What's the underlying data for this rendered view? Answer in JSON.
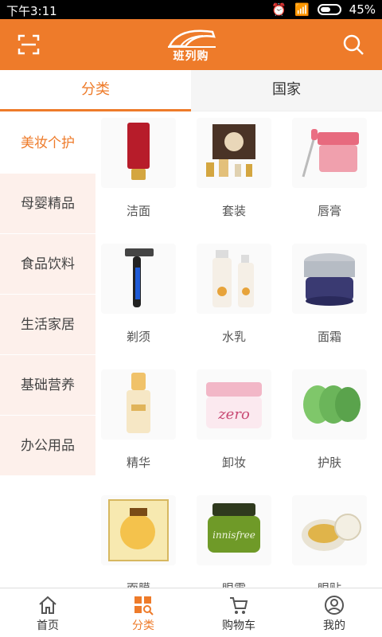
{
  "status_bar": {
    "time": "下午3:11",
    "battery": "45%"
  },
  "header": {
    "logo_text": "班列购"
  },
  "tabs": [
    {
      "label": "分类",
      "active": true
    },
    {
      "label": "国家",
      "active": false
    }
  ],
  "sidebar": {
    "items": [
      {
        "label": "美妆个护",
        "active": true
      },
      {
        "label": "母婴精品",
        "active": false
      },
      {
        "label": "食品饮料",
        "active": false
      },
      {
        "label": "生活家居",
        "active": false
      },
      {
        "label": "基础营养",
        "active": false
      },
      {
        "label": "办公用品",
        "active": false
      }
    ]
  },
  "grid": {
    "items": [
      {
        "label": "洁面",
        "icon": "cleanser-tube"
      },
      {
        "label": "套装",
        "icon": "gift-set"
      },
      {
        "label": "唇膏",
        "icon": "lip-mask-jar"
      },
      {
        "label": "剃须",
        "icon": "razor"
      },
      {
        "label": "水乳",
        "icon": "lotion-bottles"
      },
      {
        "label": "面霜",
        "icon": "cream-jar"
      },
      {
        "label": "精华",
        "icon": "serum-bottle"
      },
      {
        "label": "卸妆",
        "icon": "cleansing-balm"
      },
      {
        "label": "护肤",
        "icon": "aloe-pads"
      },
      {
        "label": "面膜",
        "icon": "face-mask-box"
      },
      {
        "label": "眼霜",
        "icon": "green-eye-cream"
      },
      {
        "label": "眼贴",
        "icon": "eye-patch-jar"
      }
    ]
  },
  "bottom_nav": [
    {
      "label": "首页",
      "icon": "home-icon",
      "active": false
    },
    {
      "label": "分类",
      "icon": "category-icon",
      "active": true
    },
    {
      "label": "购物车",
      "icon": "cart-icon",
      "active": false
    },
    {
      "label": "我的",
      "icon": "profile-icon",
      "active": false
    }
  ],
  "colors": {
    "accent": "#ee7b2a",
    "sidebar_bg": "#fdf0eb"
  }
}
